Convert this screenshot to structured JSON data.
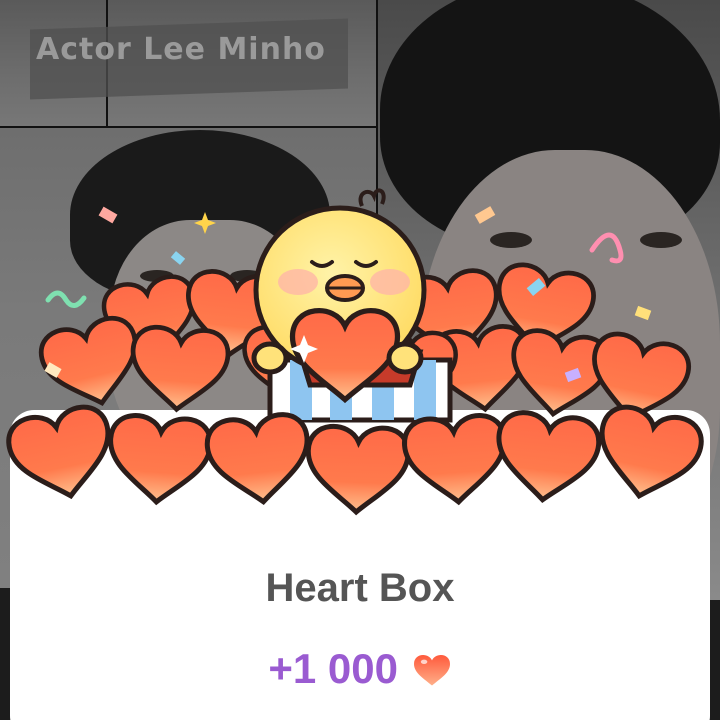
{
  "header": {
    "caption": "Actor Lee Minho"
  },
  "reward_card": {
    "title": "Heart Box",
    "amount": "+1 000",
    "currency_icon": "heart-icon"
  },
  "colors": {
    "heart": "#ff5a3c",
    "heart_light": "#ffb08a",
    "amount_text": "#9a5bd1",
    "title_text": "#555555",
    "chick": "#ffe27a"
  }
}
